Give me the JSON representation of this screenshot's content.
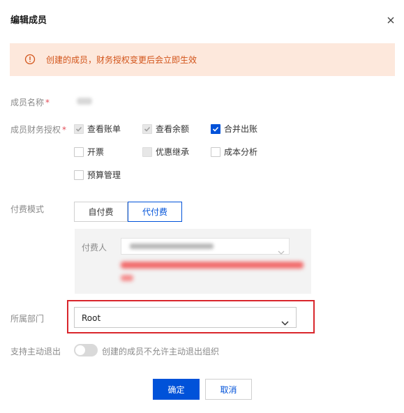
{
  "dialog": {
    "title": "编辑成员",
    "close_icon": "close-icon"
  },
  "alert": {
    "icon": "warning-circle-icon",
    "text": "创建的成员，财务授权变更后会立即生效",
    "color": "#d2541a"
  },
  "form": {
    "name_label": "成员名称",
    "required_mark": "*",
    "permissions_label": "成员财务授权",
    "permissions": [
      {
        "label": "查看账单",
        "state": "checked-disabled"
      },
      {
        "label": "查看余额",
        "state": "checked-disabled"
      },
      {
        "label": "合并出账",
        "state": "checked"
      },
      {
        "label": "开票",
        "state": "unchecked"
      },
      {
        "label": "优惠继承",
        "state": "disabled"
      },
      {
        "label": "成本分析",
        "state": "unchecked"
      },
      {
        "label": "预算管理",
        "state": "unchecked"
      }
    ],
    "pay_mode_label": "付费模式",
    "pay_modes": [
      "自付费",
      "代付费"
    ],
    "pay_mode_selected": "代付费",
    "payer_label": "付费人",
    "dept_label": "所属部门",
    "dept_value": "Root",
    "exit_label": "支持主动退出",
    "exit_hint": "创建的成员不允许主动退出组织"
  },
  "footer": {
    "ok_label": "确定",
    "cancel_label": "取消"
  },
  "colors": {
    "primary": "#0052d9",
    "alert_bg": "#fde8dc",
    "highlight": "#d9262c"
  }
}
